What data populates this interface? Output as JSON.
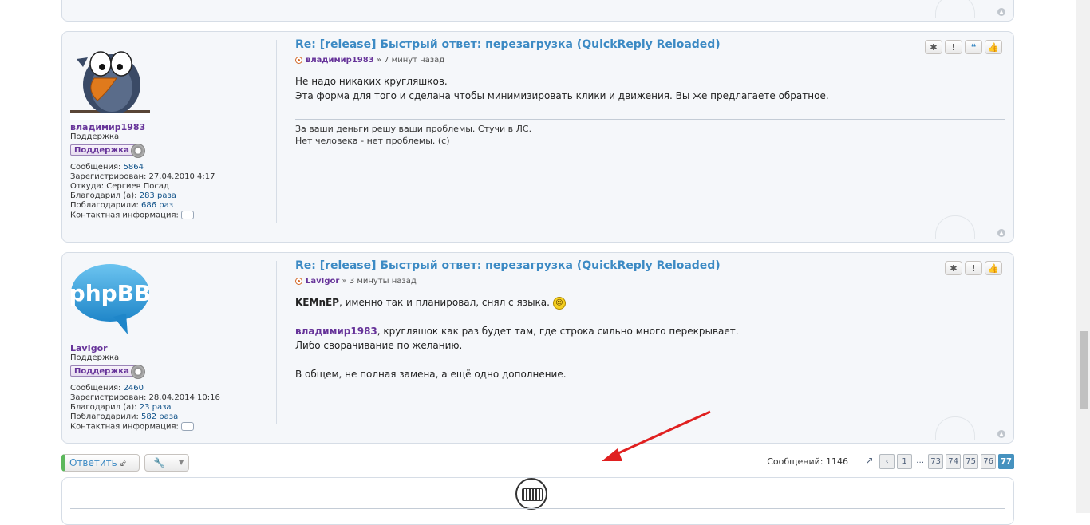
{
  "posts": [
    {
      "title": "Re: [release] Быстрый ответ: перезагрузка (QuickReply Reloaded)",
      "author": "владимир1983",
      "time_sep": " » ",
      "time": "7 минут назад",
      "avatar": "bird-avatar",
      "username": "владимир1983",
      "rank_title": "Поддержка",
      "rank_badge": "Поддержка",
      "stats": [
        {
          "label": "Сообщения: ",
          "value": "5864",
          "link": true
        },
        {
          "label": "Зарегистрирован: ",
          "value": "27.04.2010 4:17",
          "link": false
        },
        {
          "label": "Откуда: ",
          "value": "Сергиев Посад",
          "link": false
        },
        {
          "label": "Благодарил (а): ",
          "value": "283 раза",
          "link": true
        },
        {
          "label": "Поблагодарили: ",
          "value": "686 раз",
          "link": true
        }
      ],
      "contact_label": "Контактная информация:",
      "content": [
        "Не надо никаких кругляшков.",
        "Эта форма для того и сделана чтобы минимизировать клики и движения. Вы же предлагаете обратное."
      ],
      "signature": [
        "За ваши деньги решу ваши проблемы. Стучи в ЛС.",
        "Нет человека - нет проблемы. (с)"
      ]
    },
    {
      "title": "Re: [release] Быстрый ответ: перезагрузка (QuickReply Reloaded)",
      "author": "LavIgor",
      "time_sep": " » ",
      "time": "3 минуты назад",
      "avatar": "phpbb-logo",
      "avatar_text": "phpBB",
      "username": "LavIgor",
      "rank_title": "Поддержка",
      "rank_badge": "Поддержка",
      "stats": [
        {
          "label": "Сообщения: ",
          "value": "2460",
          "link": true
        },
        {
          "label": "Зарегистрирован: ",
          "value": "28.04.2014 10:16",
          "link": false
        },
        {
          "label": "Благодарил (а): ",
          "value": "23 раза",
          "link": true
        },
        {
          "label": "Поблагодарили: ",
          "value": "582 раза",
          "link": true
        }
      ],
      "contact_label": "Контактная информация:",
      "content": {
        "line1_name": "KEMnEP",
        "line1_rest": ", именно так и планировал, снял с языка. ",
        "line2_name": "владимир1983",
        "line2_rest": ", кругляшок как раз будет там, где строка сильно много перекрывает.",
        "line3": "Либо сворачивание по желанию.",
        "line4": "В общем, не полная замена, а ещё одно дополнение."
      }
    }
  ],
  "action_bar": {
    "reply_label": "Ответить",
    "post_count_label": "Сообщений: 1146",
    "pages": [
      "1",
      "…",
      "73",
      "74",
      "75",
      "76",
      "77"
    ],
    "current_page": "77"
  },
  "colors": {
    "title": "#3c8ac4",
    "username": "#663399",
    "link": "#105289",
    "pager_current": "#4692bf",
    "annotation_arrow": "#e02020"
  },
  "icons": [
    "report-icon",
    "warn-icon",
    "quote-icon",
    "like-icon",
    "top-icon",
    "external-link-icon",
    "chevron-left-icon",
    "wrench-icon",
    "keyboard-icon"
  ]
}
